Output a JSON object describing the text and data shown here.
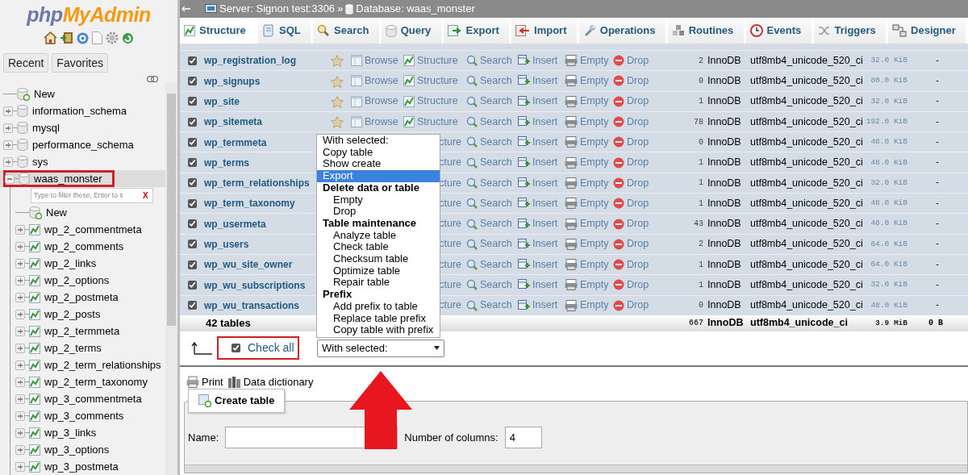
{
  "sidebar": {
    "logo": {
      "parts": [
        "php",
        "MyAdmin"
      ]
    },
    "buttons": [
      {
        "label": "Recent"
      },
      {
        "label": "Favorites"
      }
    ],
    "tree": [
      {
        "label": "New",
        "kind": "new",
        "outlined": false
      },
      {
        "label": "information_schema",
        "kind": "database",
        "expanded": false,
        "outlined": false
      },
      {
        "label": "mysql",
        "kind": "database",
        "expanded": false,
        "outlined": false
      },
      {
        "label": "performance_schema",
        "kind": "database",
        "expanded": false,
        "outlined": false
      },
      {
        "label": "sys",
        "kind": "database",
        "expanded": false,
        "outlined": false
      },
      {
        "label": "waas_monster",
        "kind": "database",
        "expanded": true,
        "outlined": true,
        "filter": {
          "placeholder": "Type to filter these, Enter to s",
          "clear": "X"
        },
        "children": [
          {
            "label": "New",
            "kind": "new"
          },
          {
            "label": "wp_2_commentmeta",
            "kind": "table",
            "expanded": false
          },
          {
            "label": "wp_2_comments",
            "kind": "table",
            "expanded": false
          },
          {
            "label": "wp_2_links",
            "kind": "table",
            "expanded": false
          },
          {
            "label": "wp_2_options",
            "kind": "table",
            "expanded": false
          },
          {
            "label": "wp_2_postmeta",
            "kind": "table",
            "expanded": false
          },
          {
            "label": "wp_2_posts",
            "kind": "table",
            "expanded": false
          },
          {
            "label": "wp_2_termmeta",
            "kind": "table",
            "expanded": false
          },
          {
            "label": "wp_2_terms",
            "kind": "table",
            "expanded": false
          },
          {
            "label": "wp_2_term_relationships",
            "kind": "table",
            "expanded": false
          },
          {
            "label": "wp_2_term_taxonomy",
            "kind": "table",
            "expanded": false
          },
          {
            "label": "wp_3_commentmeta",
            "kind": "table",
            "expanded": false
          },
          {
            "label": "wp_3_comments",
            "kind": "table",
            "expanded": false
          },
          {
            "label": "wp_3_links",
            "kind": "table",
            "expanded": false
          },
          {
            "label": "wp_3_options",
            "kind": "table",
            "expanded": false
          },
          {
            "label": "wp_3_postmeta",
            "kind": "table",
            "expanded": false
          }
        ]
      }
    ]
  },
  "breadcrumb": {
    "server": "Server: Signon test:3306",
    "separator": "»",
    "database": "Database: waas_monster"
  },
  "tabs": [
    {
      "label": "Structure",
      "selected": true
    },
    {
      "label": "SQL",
      "selected": false
    },
    {
      "label": "Search",
      "selected": false
    },
    {
      "label": "Query",
      "selected": false
    },
    {
      "label": "Export",
      "selected": false
    },
    {
      "label": "Import",
      "selected": false
    },
    {
      "label": "Operations",
      "selected": false
    },
    {
      "label": "Routines",
      "selected": false
    },
    {
      "label": "Events",
      "selected": false
    },
    {
      "label": "Triggers",
      "selected": false
    },
    {
      "label": "Designer",
      "selected": false
    }
  ],
  "table": {
    "rows": [
      {
        "name": "wp_registration_log",
        "checked": true,
        "actions": [
          {
            "kind": "favorite"
          },
          {
            "kind": "browse",
            "label": "Browse"
          },
          {
            "kind": "structure",
            "label": "Structure",
            "clipped": false
          },
          {
            "kind": "search",
            "label": "Search"
          },
          {
            "kind": "insert",
            "label": "Insert"
          },
          {
            "kind": "empty",
            "label": "Empty"
          },
          {
            "kind": "drop",
            "label": "Drop"
          }
        ],
        "rows": "2",
        "engine": "InnoDB",
        "collation": "utf8mb4_unicode_520_ci",
        "size": "32.0 KiB",
        "overhead": "-"
      },
      {
        "name": "wp_signups",
        "checked": true,
        "actions": [
          {
            "kind": "favorite"
          },
          {
            "kind": "browse",
            "label": "Browse"
          },
          {
            "kind": "structure",
            "label": "Structure",
            "clipped": false
          },
          {
            "kind": "search",
            "label": "Search"
          },
          {
            "kind": "insert",
            "label": "Insert"
          },
          {
            "kind": "empty",
            "label": "Empty"
          },
          {
            "kind": "drop",
            "label": "Drop"
          }
        ],
        "rows": "0",
        "engine": "InnoDB",
        "collation": "utf8mb4_unicode_520_ci",
        "size": "80.0 KiB",
        "overhead": "-"
      },
      {
        "name": "wp_site",
        "checked": true,
        "actions": [
          {
            "kind": "favorite"
          },
          {
            "kind": "browse",
            "label": "Browse"
          },
          {
            "kind": "structure",
            "label": "Structure",
            "clipped": false
          },
          {
            "kind": "search",
            "label": "Search"
          },
          {
            "kind": "insert",
            "label": "Insert"
          },
          {
            "kind": "empty",
            "label": "Empty"
          },
          {
            "kind": "drop",
            "label": "Drop"
          }
        ],
        "rows": "1",
        "engine": "InnoDB",
        "collation": "utf8mb4_unicode_520_ci",
        "size": "32.0 KiB",
        "overhead": "-"
      },
      {
        "name": "wp_sitemeta",
        "checked": true,
        "actions": [
          {
            "kind": "favorite"
          },
          {
            "kind": "browse",
            "label": "Browse"
          },
          {
            "kind": "structure",
            "label": "Structure",
            "clipped": false
          },
          {
            "kind": "search",
            "label": "Search"
          },
          {
            "kind": "insert",
            "label": "Insert"
          },
          {
            "kind": "empty",
            "label": "Empty"
          },
          {
            "kind": "drop",
            "label": "Drop"
          }
        ],
        "rows": "78",
        "engine": "InnoDB",
        "collation": "utf8mb4_unicode_520_ci",
        "size": "192.0 KiB",
        "overhead": "-"
      },
      {
        "name": "wp_termmeta",
        "checked": true,
        "actions": [
          {
            "kind": "structure",
            "label": "cture",
            "clipped": true
          },
          {
            "kind": "search",
            "label": "Search"
          },
          {
            "kind": "insert",
            "label": "Insert"
          },
          {
            "kind": "empty",
            "label": "Empty"
          },
          {
            "kind": "drop",
            "label": "Drop"
          }
        ],
        "rows": "0",
        "engine": "InnoDB",
        "collation": "utf8mb4_unicode_520_ci",
        "size": "48.0 KiB",
        "overhead": "-"
      },
      {
        "name": "wp_terms",
        "checked": true,
        "actions": [
          {
            "kind": "structure",
            "label": "cture",
            "clipped": true
          },
          {
            "kind": "search",
            "label": "Search"
          },
          {
            "kind": "insert",
            "label": "Insert"
          },
          {
            "kind": "empty",
            "label": "Empty"
          },
          {
            "kind": "drop",
            "label": "Drop"
          }
        ],
        "rows": "1",
        "engine": "InnoDB",
        "collation": "utf8mb4_unicode_520_ci",
        "size": "48.0 KiB",
        "overhead": "-"
      },
      {
        "name": "wp_term_relationships",
        "checked": true,
        "actions": [
          {
            "kind": "structure",
            "label": "cture",
            "clipped": true
          },
          {
            "kind": "search",
            "label": "Search"
          },
          {
            "kind": "insert",
            "label": "Insert"
          },
          {
            "kind": "empty",
            "label": "Empty"
          },
          {
            "kind": "drop",
            "label": "Drop"
          }
        ],
        "rows": "1",
        "engine": "InnoDB",
        "collation": "utf8mb4_unicode_520_ci",
        "size": "32.0 KiB",
        "overhead": "-"
      },
      {
        "name": "wp_term_taxonomy",
        "checked": true,
        "actions": [
          {
            "kind": "structure",
            "label": "cture",
            "clipped": true
          },
          {
            "kind": "search",
            "label": "Search"
          },
          {
            "kind": "insert",
            "label": "Insert"
          },
          {
            "kind": "empty",
            "label": "Empty"
          },
          {
            "kind": "drop",
            "label": "Drop"
          }
        ],
        "rows": "1",
        "engine": "InnoDB",
        "collation": "utf8mb4_unicode_520_ci",
        "size": "48.0 KiB",
        "overhead": "-"
      },
      {
        "name": "wp_usermeta",
        "checked": true,
        "actions": [
          {
            "kind": "structure",
            "label": "cture",
            "clipped": true
          },
          {
            "kind": "search",
            "label": "Search"
          },
          {
            "kind": "insert",
            "label": "Insert"
          },
          {
            "kind": "empty",
            "label": "Empty"
          },
          {
            "kind": "drop",
            "label": "Drop"
          }
        ],
        "rows": "43",
        "engine": "InnoDB",
        "collation": "utf8mb4_unicode_520_ci",
        "size": "48.0 KiB",
        "overhead": "-"
      },
      {
        "name": "wp_users",
        "checked": true,
        "actions": [
          {
            "kind": "structure",
            "label": "cture",
            "clipped": true
          },
          {
            "kind": "search",
            "label": "Search"
          },
          {
            "kind": "insert",
            "label": "Insert"
          },
          {
            "kind": "empty",
            "label": "Empty"
          },
          {
            "kind": "drop",
            "label": "Drop"
          }
        ],
        "rows": "2",
        "engine": "InnoDB",
        "collation": "utf8mb4_unicode_520_ci",
        "size": "64.0 KiB",
        "overhead": "-"
      },
      {
        "name": "wp_wu_site_owner",
        "checked": true,
        "actions": [
          {
            "kind": "structure",
            "label": "cture",
            "clipped": true
          },
          {
            "kind": "search",
            "label": "Search"
          },
          {
            "kind": "insert",
            "label": "Insert"
          },
          {
            "kind": "empty",
            "label": "Empty"
          },
          {
            "kind": "drop",
            "label": "Drop"
          }
        ],
        "rows": "1",
        "engine": "InnoDB",
        "collation": "utf8mb4_unicode_520_ci",
        "size": "64.0 KiB",
        "overhead": "-"
      },
      {
        "name": "wp_wu_subscriptions",
        "checked": true,
        "actions": [
          {
            "kind": "structure",
            "label": "cture",
            "clipped": true
          },
          {
            "kind": "search",
            "label": "Search"
          },
          {
            "kind": "insert",
            "label": "Insert"
          },
          {
            "kind": "empty",
            "label": "Empty"
          },
          {
            "kind": "drop",
            "label": "Drop"
          }
        ],
        "rows": "1",
        "engine": "InnoDB",
        "collation": "utf8mb4_unicode_520_ci",
        "size": "32.0 KiB",
        "overhead": "-"
      },
      {
        "name": "wp_wu_transactions",
        "checked": true,
        "actions": [
          {
            "kind": "structure",
            "label": "cture",
            "clipped": true
          },
          {
            "kind": "search",
            "label": "Search"
          },
          {
            "kind": "insert",
            "label": "Insert"
          },
          {
            "kind": "empty",
            "label": "Empty"
          },
          {
            "kind": "drop",
            "label": "Drop"
          }
        ],
        "rows": "0",
        "engine": "InnoDB",
        "collation": "utf8mb4_unicode_520_ci",
        "size": "48.0 KiB",
        "overhead": "-"
      }
    ],
    "footer": {
      "label": "42 tables",
      "rows": "667",
      "engine": "InnoDB",
      "collation": "utf8mb4_unicode_ci",
      "size": "3.9 MiB",
      "overhead": "0 B"
    }
  },
  "bulk": {
    "check_all": {
      "label": "Check all",
      "checked": true,
      "outlined": true
    },
    "select": {
      "value": "With selected:"
    },
    "menu": [
      {
        "kind": "option",
        "label": "With selected:",
        "selected": false
      },
      {
        "kind": "option",
        "label": "Copy table",
        "selected": false
      },
      {
        "kind": "option",
        "label": "Show create",
        "selected": false
      },
      {
        "kind": "option",
        "label": "Export",
        "selected": true
      },
      {
        "kind": "group",
        "label": "Delete data or table",
        "children": [
          {
            "label": "Empty",
            "selected": false
          },
          {
            "label": "Drop",
            "selected": false
          }
        ]
      },
      {
        "kind": "group",
        "label": "Table maintenance",
        "children": [
          {
            "label": "Analyze table",
            "selected": false
          },
          {
            "label": "Check table",
            "selected": false
          },
          {
            "label": "Checksum table",
            "selected": false
          },
          {
            "label": "Optimize table",
            "selected": false
          },
          {
            "label": "Repair table",
            "selected": false
          }
        ]
      },
      {
        "kind": "group",
        "label": "Prefix",
        "children": [
          {
            "label": "Add prefix to table",
            "selected": false
          },
          {
            "label": "Replace table prefix",
            "selected": false
          },
          {
            "label": "Copy table with prefix",
            "selected": false
          }
        ]
      }
    ]
  },
  "links": [
    {
      "label": "Print"
    },
    {
      "label": "Data dictionary"
    }
  ],
  "create_table": {
    "title": "Create table",
    "name_label": "Name:",
    "columns_label": "Number of columns:",
    "columns_value": "4"
  },
  "annotation": {
    "kind": "arrow"
  }
}
